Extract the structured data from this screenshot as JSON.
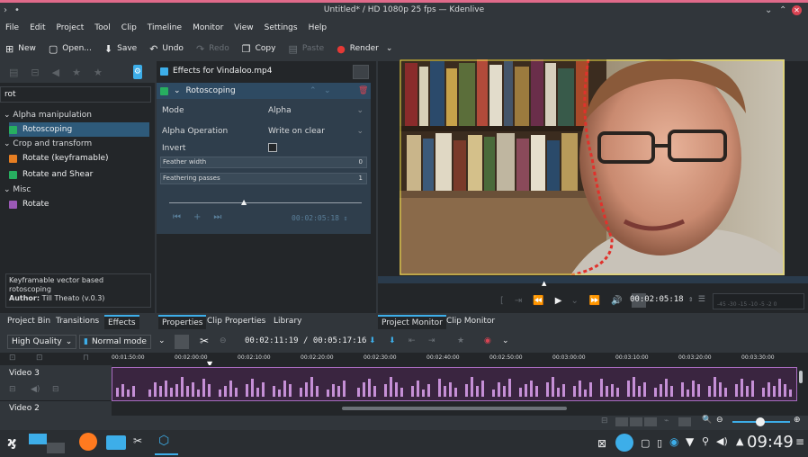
{
  "window": {
    "title": "Untitled* / HD 1080p 25 fps — Kdenlive"
  },
  "menu": [
    "File",
    "Edit",
    "Project",
    "Tool",
    "Clip",
    "Timeline",
    "Monitor",
    "View",
    "Settings",
    "Help"
  ],
  "toolbar": {
    "new": "New",
    "open": "Open...",
    "save": "Save",
    "undo": "Undo",
    "redo": "Redo",
    "copy": "Copy",
    "paste": "Paste",
    "render": "Render"
  },
  "effects_panel": {
    "search_value": "rot",
    "categories": [
      {
        "label": "Alpha manipulation",
        "items": [
          {
            "label": "Rotoscoping",
            "color": "#27ae60",
            "selected": true
          }
        ]
      },
      {
        "label": "Crop and transform",
        "items": [
          {
            "label": "Rotate (keyframable)",
            "color": "#e67e22",
            "selected": false
          },
          {
            "label": "Rotate and Shear",
            "color": "#27ae60",
            "selected": false
          }
        ]
      },
      {
        "label": "Misc",
        "items": [
          {
            "label": "Rotate",
            "color": "#9b59b6",
            "selected": false
          }
        ]
      }
    ],
    "description": "Keyframable vector based rotoscoping",
    "author_label": "Author:",
    "author": "Till Theato (v.0.3)"
  },
  "effect_stack": {
    "header": "Effects for Vindaloo.mp4",
    "effect_name": "Rotoscoping",
    "mode_label": "Mode",
    "mode_value": "Alpha",
    "alpha_op_label": "Alpha Operation",
    "alpha_op_value": "Write on clear",
    "invert_label": "Invert",
    "feather_width_label": "Feather width",
    "feather_width_value": "0",
    "feather_passes_label": "Feathering passes",
    "feather_passes_value": "1",
    "keyframe_timecode": "00:02:05:18"
  },
  "monitor": {
    "timecode": "00:02:05:18",
    "audio_scale": "-45 -30   -15 -10  -5  -2  0"
  },
  "bottom_tabs_left": [
    "Project Bin",
    "Transitions",
    "Effects"
  ],
  "bottom_tabs_mid": [
    "Properties",
    "Clip Properties",
    "Library"
  ],
  "bottom_tabs_right": [
    "Project Monitor",
    "Clip Monitor"
  ],
  "timeline_toolbar": {
    "quality": "High Quality",
    "mode": "Normal mode",
    "position": "00:02:11:19 / 00:05:17:16"
  },
  "ruler_ticks": [
    "00:01:50:00",
    "00:02:00:00",
    "00:02:10:00",
    "00:02:20:00",
    "00:02:30:00",
    "00:02:40:00",
    "00:02:50:00",
    "00:03:00:00",
    "00:03:10:00",
    "00:03:20:00",
    "00:03:30:00"
  ],
  "tracks": [
    "Video 3",
    "Video 2"
  ],
  "taskbar": {
    "clock": "09:49"
  },
  "colors": {
    "accent": "#3daee9",
    "selection": "#2e5a7a",
    "audio_wave": "#b57bc4",
    "render_dot": "#e53935",
    "roto_spline": "#e0322c"
  }
}
